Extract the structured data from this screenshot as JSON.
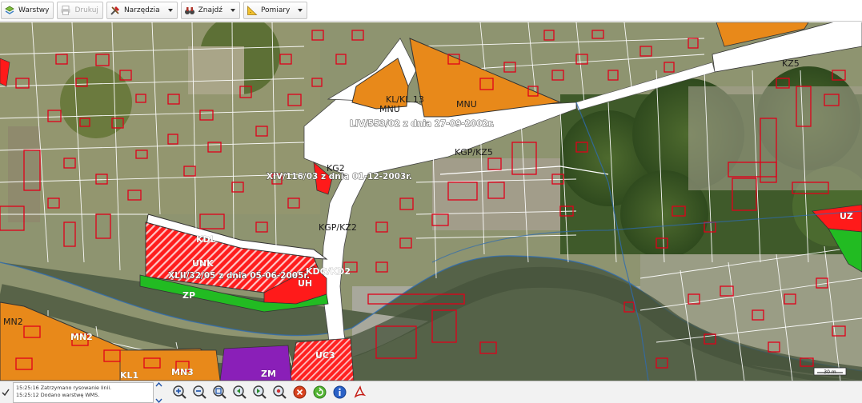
{
  "toolbar": {
    "layers_label": "Warstwy",
    "print_label": "Drukuj",
    "tools_label": "Narzędzia",
    "find_label": "Znajdź",
    "measure_label": "Pomiary"
  },
  "map": {
    "zone_labels": {
      "kz5": "KZ5",
      "mnu_top_left": "MNU",
      "kl13": "KL/KL 13",
      "mnu_top_mid": "MNU",
      "mnu_top_right": "MNU",
      "kg2": "KG2",
      "kgp_kz5": "KGP/KZ5",
      "kgp_kz2": "KGP/KZ2",
      "kdl": "KDL",
      "unk": "UNK",
      "uh": "UH",
      "kdg_kd2": "KDG/KD2",
      "zp": "ZP",
      "uz": "UZ",
      "mn2_left": "MN2",
      "mn2_mid": "MN2",
      "kl1": "KL1",
      "mn3": "MN3",
      "uc3": "UC3",
      "zm": "ZM"
    },
    "resolutions": {
      "r1": "LIV/553/02 z dnia 27-09-2002r.",
      "r2": "XIV/116/03 z dnia 01-12-2003r.",
      "r3": "XLII/32/05 z dnia 05-06-2005r."
    },
    "scale_label": "30 m"
  },
  "status": {
    "log_lines": [
      "15:25:16 Zatrzymano rysowanie linii.",
      "15:25:12 Dodano warstwę WMS."
    ]
  },
  "tools": [
    "zoom-in-icon",
    "zoom-out-icon",
    "zoom-extent-icon",
    "zoom-previous-icon",
    "zoom-next-icon",
    "zoom-window-icon",
    "stop-icon",
    "refresh-icon",
    "info-icon",
    "pdf-icon"
  ],
  "colors": {
    "orange_zone": "#e88b1a",
    "red_zone": "#ff0000",
    "green_zone": "#22bb22",
    "purple_zone": "#8a1fb8",
    "building_outline": "#e0001a",
    "river": "#4f5a48"
  }
}
